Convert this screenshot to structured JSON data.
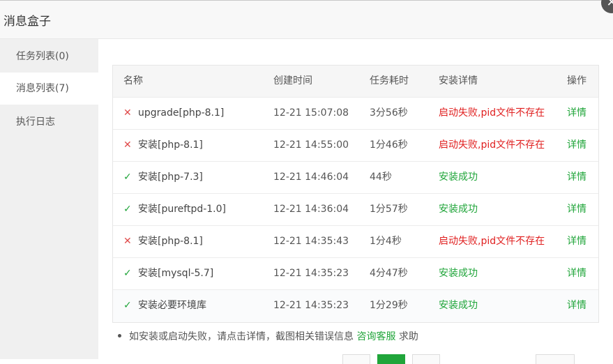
{
  "dialog": {
    "title": "消息盒子"
  },
  "sidebar": {
    "items": [
      {
        "label": "任务列表(0)",
        "active": false
      },
      {
        "label": "消息列表(7)",
        "active": true
      },
      {
        "label": "执行日志",
        "active": false
      }
    ]
  },
  "table": {
    "headers": [
      "名称",
      "创建时间",
      "任务耗时",
      "安装详情",
      "操作"
    ],
    "rows": [
      {
        "status": "fail",
        "name": "upgrade[php-8.1]",
        "time": "12-21 15:07:08",
        "duration": "3分56秒",
        "detail": "启动失败,pid文件不存在",
        "action": "详情"
      },
      {
        "status": "fail",
        "name": "安装[php-8.1]",
        "time": "12-21 14:55:00",
        "duration": "1分46秒",
        "detail": "启动失败,pid文件不存在",
        "action": "详情"
      },
      {
        "status": "ok",
        "name": "安装[php-7.3]",
        "time": "12-21 14:46:04",
        "duration": "44秒",
        "detail": "安装成功",
        "action": "详情"
      },
      {
        "status": "ok",
        "name": "安装[pureftpd-1.0]",
        "time": "12-21 14:36:04",
        "duration": "1分57秒",
        "detail": "安装成功",
        "action": "详情"
      },
      {
        "status": "fail",
        "name": "安装[php-8.1]",
        "time": "12-21 14:35:43",
        "duration": "1分4秒",
        "detail": "启动失败,pid文件不存在",
        "action": "详情"
      },
      {
        "status": "ok",
        "name": "安装[mysql-5.7]",
        "time": "12-21 14:35:23",
        "duration": "4分47秒",
        "detail": "安装成功",
        "action": "详情"
      },
      {
        "status": "ok",
        "name": "安装必要环境库",
        "time": "12-21 14:35:23",
        "duration": "1分29秒",
        "detail": "安装成功",
        "action": "详情"
      }
    ]
  },
  "tips": {
    "text": "如安装或启动失败，请点击详情，截图相关错误信息",
    "link": "咨询客服",
    "suffix": "求助"
  },
  "icons": {
    "fail": "✕",
    "ok": "✓",
    "close": "✕"
  },
  "colors": {
    "accent": "#20a53a",
    "error": "#e02020"
  }
}
